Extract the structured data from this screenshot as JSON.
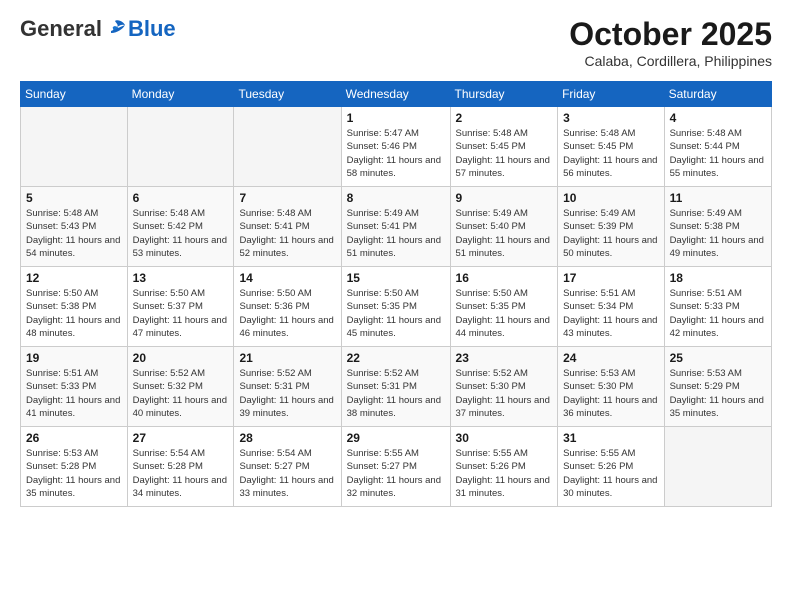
{
  "header": {
    "logo_general": "General",
    "logo_blue": "Blue",
    "month_title": "October 2025",
    "location": "Calaba, Cordillera, Philippines"
  },
  "weekdays": [
    "Sunday",
    "Monday",
    "Tuesday",
    "Wednesday",
    "Thursday",
    "Friday",
    "Saturday"
  ],
  "weeks": [
    [
      {
        "day": "",
        "sunrise": "",
        "sunset": "",
        "daylight": ""
      },
      {
        "day": "",
        "sunrise": "",
        "sunset": "",
        "daylight": ""
      },
      {
        "day": "",
        "sunrise": "",
        "sunset": "",
        "daylight": ""
      },
      {
        "day": "1",
        "sunrise": "Sunrise: 5:47 AM",
        "sunset": "Sunset: 5:46 PM",
        "daylight": "Daylight: 11 hours and 58 minutes."
      },
      {
        "day": "2",
        "sunrise": "Sunrise: 5:48 AM",
        "sunset": "Sunset: 5:45 PM",
        "daylight": "Daylight: 11 hours and 57 minutes."
      },
      {
        "day": "3",
        "sunrise": "Sunrise: 5:48 AM",
        "sunset": "Sunset: 5:45 PM",
        "daylight": "Daylight: 11 hours and 56 minutes."
      },
      {
        "day": "4",
        "sunrise": "Sunrise: 5:48 AM",
        "sunset": "Sunset: 5:44 PM",
        "daylight": "Daylight: 11 hours and 55 minutes."
      }
    ],
    [
      {
        "day": "5",
        "sunrise": "Sunrise: 5:48 AM",
        "sunset": "Sunset: 5:43 PM",
        "daylight": "Daylight: 11 hours and 54 minutes."
      },
      {
        "day": "6",
        "sunrise": "Sunrise: 5:48 AM",
        "sunset": "Sunset: 5:42 PM",
        "daylight": "Daylight: 11 hours and 53 minutes."
      },
      {
        "day": "7",
        "sunrise": "Sunrise: 5:48 AM",
        "sunset": "Sunset: 5:41 PM",
        "daylight": "Daylight: 11 hours and 52 minutes."
      },
      {
        "day": "8",
        "sunrise": "Sunrise: 5:49 AM",
        "sunset": "Sunset: 5:41 PM",
        "daylight": "Daylight: 11 hours and 51 minutes."
      },
      {
        "day": "9",
        "sunrise": "Sunrise: 5:49 AM",
        "sunset": "Sunset: 5:40 PM",
        "daylight": "Daylight: 11 hours and 51 minutes."
      },
      {
        "day": "10",
        "sunrise": "Sunrise: 5:49 AM",
        "sunset": "Sunset: 5:39 PM",
        "daylight": "Daylight: 11 hours and 50 minutes."
      },
      {
        "day": "11",
        "sunrise": "Sunrise: 5:49 AM",
        "sunset": "Sunset: 5:38 PM",
        "daylight": "Daylight: 11 hours and 49 minutes."
      }
    ],
    [
      {
        "day": "12",
        "sunrise": "Sunrise: 5:50 AM",
        "sunset": "Sunset: 5:38 PM",
        "daylight": "Daylight: 11 hours and 48 minutes."
      },
      {
        "day": "13",
        "sunrise": "Sunrise: 5:50 AM",
        "sunset": "Sunset: 5:37 PM",
        "daylight": "Daylight: 11 hours and 47 minutes."
      },
      {
        "day": "14",
        "sunrise": "Sunrise: 5:50 AM",
        "sunset": "Sunset: 5:36 PM",
        "daylight": "Daylight: 11 hours and 46 minutes."
      },
      {
        "day": "15",
        "sunrise": "Sunrise: 5:50 AM",
        "sunset": "Sunset: 5:35 PM",
        "daylight": "Daylight: 11 hours and 45 minutes."
      },
      {
        "day": "16",
        "sunrise": "Sunrise: 5:50 AM",
        "sunset": "Sunset: 5:35 PM",
        "daylight": "Daylight: 11 hours and 44 minutes."
      },
      {
        "day": "17",
        "sunrise": "Sunrise: 5:51 AM",
        "sunset": "Sunset: 5:34 PM",
        "daylight": "Daylight: 11 hours and 43 minutes."
      },
      {
        "day": "18",
        "sunrise": "Sunrise: 5:51 AM",
        "sunset": "Sunset: 5:33 PM",
        "daylight": "Daylight: 11 hours and 42 minutes."
      }
    ],
    [
      {
        "day": "19",
        "sunrise": "Sunrise: 5:51 AM",
        "sunset": "Sunset: 5:33 PM",
        "daylight": "Daylight: 11 hours and 41 minutes."
      },
      {
        "day": "20",
        "sunrise": "Sunrise: 5:52 AM",
        "sunset": "Sunset: 5:32 PM",
        "daylight": "Daylight: 11 hours and 40 minutes."
      },
      {
        "day": "21",
        "sunrise": "Sunrise: 5:52 AM",
        "sunset": "Sunset: 5:31 PM",
        "daylight": "Daylight: 11 hours and 39 minutes."
      },
      {
        "day": "22",
        "sunrise": "Sunrise: 5:52 AM",
        "sunset": "Sunset: 5:31 PM",
        "daylight": "Daylight: 11 hours and 38 minutes."
      },
      {
        "day": "23",
        "sunrise": "Sunrise: 5:52 AM",
        "sunset": "Sunset: 5:30 PM",
        "daylight": "Daylight: 11 hours and 37 minutes."
      },
      {
        "day": "24",
        "sunrise": "Sunrise: 5:53 AM",
        "sunset": "Sunset: 5:30 PM",
        "daylight": "Daylight: 11 hours and 36 minutes."
      },
      {
        "day": "25",
        "sunrise": "Sunrise: 5:53 AM",
        "sunset": "Sunset: 5:29 PM",
        "daylight": "Daylight: 11 hours and 35 minutes."
      }
    ],
    [
      {
        "day": "26",
        "sunrise": "Sunrise: 5:53 AM",
        "sunset": "Sunset: 5:28 PM",
        "daylight": "Daylight: 11 hours and 35 minutes."
      },
      {
        "day": "27",
        "sunrise": "Sunrise: 5:54 AM",
        "sunset": "Sunset: 5:28 PM",
        "daylight": "Daylight: 11 hours and 34 minutes."
      },
      {
        "day": "28",
        "sunrise": "Sunrise: 5:54 AM",
        "sunset": "Sunset: 5:27 PM",
        "daylight": "Daylight: 11 hours and 33 minutes."
      },
      {
        "day": "29",
        "sunrise": "Sunrise: 5:55 AM",
        "sunset": "Sunset: 5:27 PM",
        "daylight": "Daylight: 11 hours and 32 minutes."
      },
      {
        "day": "30",
        "sunrise": "Sunrise: 5:55 AM",
        "sunset": "Sunset: 5:26 PM",
        "daylight": "Daylight: 11 hours and 31 minutes."
      },
      {
        "day": "31",
        "sunrise": "Sunrise: 5:55 AM",
        "sunset": "Sunset: 5:26 PM",
        "daylight": "Daylight: 11 hours and 30 minutes."
      },
      {
        "day": "",
        "sunrise": "",
        "sunset": "",
        "daylight": ""
      }
    ]
  ]
}
